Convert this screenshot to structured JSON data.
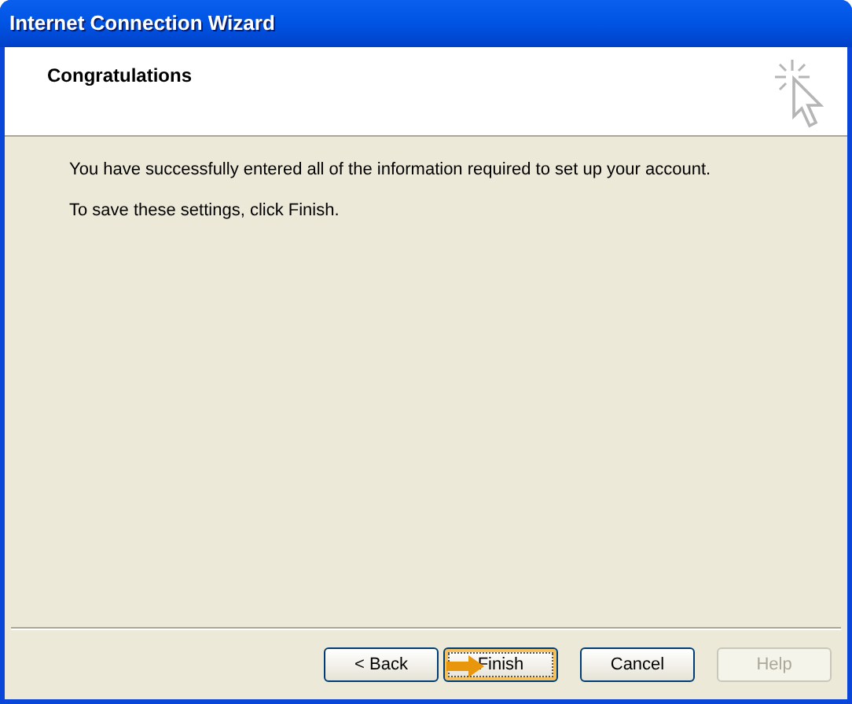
{
  "window": {
    "title": "Internet Connection Wizard"
  },
  "header": {
    "title": "Congratulations"
  },
  "body": [
    "You have successfully entered all of the information required to set up your account.",
    "To save these settings, click Finish."
  ],
  "buttons": [
    {
      "label": "< Back",
      "disabled": false,
      "focused": false
    },
    {
      "label": "Finish",
      "disabled": false,
      "focused": true
    },
    {
      "label": "Cancel",
      "disabled": false,
      "focused": false
    },
    {
      "label": "Help",
      "disabled": true,
      "focused": false
    }
  ]
}
